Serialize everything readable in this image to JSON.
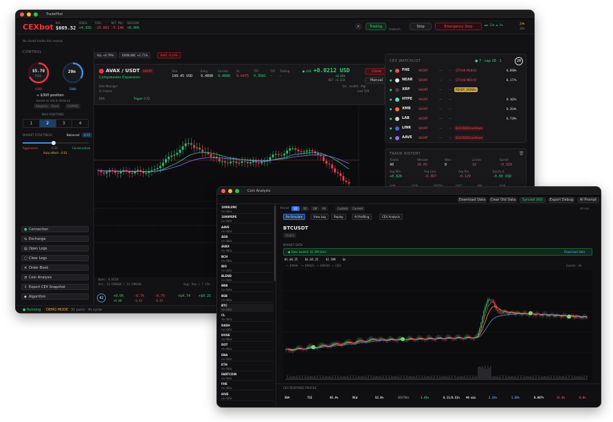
{
  "win1": {
    "title": "TradePilot",
    "logo": "CEXbot",
    "header": {
      "balance_label": "BAL",
      "balance": "$669.52",
      "gross_label": "GROSS",
      "gross": "+4.935",
      "fees_label": "FEES",
      "fees": "-10.081",
      "net_label": "NET PNL",
      "net": "-5.146",
      "session_label": "SESSION",
      "session": "+0.00%",
      "trading": "Trading",
      "trades_hr": "trades/h",
      "stop": "Stop",
      "emergency": "Emergency Stop",
      "right_top": "29%",
      "right_mid": "10%"
    },
    "notice": "No closed trades this session",
    "control": {
      "title": "CONTROL",
      "ring1_value": "$5.70",
      "ring1_label": "RISK",
      "ring2_value": "20m",
      "ring1_foot": "$760",
      "ring2_foot": "5000",
      "position": "≈ $300 position",
      "sub": "based on risk & distance",
      "chips": [
        "Adaptive",
        "Fixed",
        "CAPPED"
      ],
      "max_positions_label": "MAX POSITIONS",
      "positions": [
        "1",
        "2",
        "3",
        "4"
      ],
      "market_label": "MARKET STRICTNESS",
      "market_value": "Balanced",
      "market_badge": "0/10",
      "slider_left": "Aggressive",
      "slider_mid": "0.30",
      "slider_right": "Conservative",
      "auto_effect": "Auto effect: -0.01"
    },
    "side_buttons": [
      "Connection",
      "Exchange",
      "Open Logs",
      "Clear Logs",
      "Order Book",
      "Coin Analysis",
      "Export CEX Snapshot",
      "Algorithm"
    ],
    "status_bar": {
      "running": "Running",
      "demo": "DEMO MODE",
      "pairs": "30 pairs · 4s cycle"
    },
    "filters": [
      {
        "label": "ALL +0.79%",
        "color": "#34d27a"
      },
      {
        "label": "1000LUNC +1.71%",
        "color": "#34d27a"
      },
      {
        "label": "AVAX -0.24%",
        "color": "#ef4b55"
      }
    ],
    "position": {
      "symbol": "AVAX / USDT",
      "side": "SHORT",
      "strategy": "Compression Expansion",
      "size_label": "Size",
      "size": "199.45 USD",
      "entry_label": "Entry",
      "entry": "9.4898",
      "current_label": "Current",
      "current": "9.4880",
      "sl_label": "SL",
      "sl": "9.6475",
      "tp_label": "TP1",
      "tp": "9.3581",
      "tp2_label": "TP2",
      "tp2": "—",
      "trail_label": "Trailing",
      "trail": "—",
      "pnl": "+0.0212 USD",
      "pnl_pct": "+0.01%",
      "pnl_sub": "NET +0.038",
      "live": "LIVE",
      "close": "Close",
      "manual": "Manual",
      "info1": "Role Manager",
      "info2": "SL Frozen",
      "info3": "BNS",
      "info4": "Trigger 0.72",
      "timer": "5m · Health · Mgr",
      "last": "Last 500"
    },
    "chart_footer": {
      "open": "Open: 0.0128",
      "vol": "Vol: 23.599038 / 23.599038",
      "stats": "Avg: Rec / 7.15%",
      "pnl1": "+0.0%",
      "pnl1b": "+0.00",
      "pnl2": "-0.7%",
      "pnl2b": "-0.45",
      "pnl3": "-0.7%",
      "pnl3b": "-0.45",
      "pnl4": "+$4.74",
      "pnl5": "+$0.25",
      "circle": "42"
    },
    "watchlist": {
      "title": "CEX WATCHLIST",
      "meta": "● 7 · cap 28 · 1",
      "badge": "28",
      "rows": [
        {
          "sym": "FHE",
          "side": "SHORT",
          "pct": "0.098%",
          "ico": "#ef4b55",
          "tag": "QTF/48 M48/42",
          "tag_color": "#ef4b55",
          "tag_bg": "transparent"
        },
        {
          "sym": "NEAR",
          "side": "SHORT",
          "pct": "0.177%",
          "ico": "#e8e8ea",
          "tag": "QTF/48 M85/42",
          "tag_color": "#ef4b55",
          "tag_bg": "transparent"
        },
        {
          "sym": "XRP",
          "side": "SHORT",
          "pct": "",
          "ico": "#3c3c44",
          "tag": "READY_SIGNAL",
          "tag_color": "#0b0b0b",
          "tag_bg": "#d4a73a"
        },
        {
          "sym": "HYPE",
          "side": "SHORT",
          "pct": "0.102%",
          "ico": "#55e3c4",
          "tag": "",
          "tag_color": "",
          "tag_bg": ""
        },
        {
          "sym": "XMR",
          "side": "SHORT",
          "pct": "0.264%",
          "ico": "#f27830",
          "tag": "",
          "tag_color": "",
          "tag_bg": ""
        },
        {
          "sym": "LAB",
          "side": "SHORT",
          "pct": "0.739%",
          "ico": "#cfcfd4",
          "tag": "",
          "tag_color": "",
          "tag_bg": ""
        },
        {
          "sym": "LINK",
          "side": "SHORT",
          "pct": "",
          "ico": "#3a6cf0",
          "tag": "BLOCKED/cooldown",
          "tag_color": "#ef4b55",
          "tag_bg": "#3a1418"
        },
        {
          "sym": "AAVE",
          "side": "SHORT",
          "pct": "",
          "ico": "#9d6af0",
          "tag": "BLOCKED/cooldown",
          "tag_color": "#ef4b55",
          "tag_bg": "#3a1418"
        }
      ]
    },
    "history": {
      "title": "TRADE HISTORY",
      "cols": [
        "Trades",
        "Winrate",
        "Wins",
        "Losses",
        "Sumdl"
      ],
      "vals": [
        "40",
        "20.0%",
        "8",
        "32",
        "-0.329"
      ],
      "row2_labels": [
        "Avg Win",
        "Avg Loss",
        "Avg PnL",
        "Equity Δ"
      ],
      "row2_vals": [
        "+0.826",
        "-0.367",
        "-0.129",
        "-0.00 USD"
      ],
      "table_head": [
        "SYM",
        "SIDE",
        "ENTRY",
        "EXIT",
        "PNL",
        "DUR"
      ]
    }
  },
  "win2": {
    "title": "Coin Analysis",
    "buttons": [
      "Download Data",
      "Clear Old Data",
      "Synced (60)",
      "Export Debug",
      "AI Prompt"
    ],
    "period_label": "Period",
    "periods": [
      "1D",
      "3D",
      "1W",
      "All",
      "Custom",
      "Current"
    ],
    "actions": [
      "Re-Simulate",
      "View Log",
      "Replay",
      "AI Profiling",
      "CEX Analysis"
    ],
    "actions_right": "All sim",
    "symbol": "BTCUSDT",
    "subtitle": "Global",
    "section": "MARKET DATA",
    "loaded": "Data loaded: 42 399 bars",
    "download": "Download data",
    "legend": [
      "EMA9",
      "EMA21",
      "EMA50",
      "CEX"
    ],
    "chart_right": "Events · 4h",
    "list": [
      {
        "sym": "1000LUNC",
        "sub": "no data"
      },
      {
        "sym": "1000PEPE",
        "sub": "no data"
      },
      {
        "sym": "AAVE",
        "sub": "no data"
      },
      {
        "sym": "ADA",
        "sub": "no data"
      },
      {
        "sym": "AVAX",
        "sub": "no data"
      },
      {
        "sym": "BCH",
        "sub": "no data"
      },
      {
        "sym": "BIO",
        "sub": "no data"
      },
      {
        "sym": "BLEND",
        "sub": "no data"
      },
      {
        "sym": "BNB",
        "sub": "no data"
      },
      {
        "sym": "BSB",
        "sub": "no data"
      },
      {
        "sym": "BTC",
        "sub": "no data"
      },
      {
        "sym": "CL",
        "sub": "no data"
      },
      {
        "sym": "DASH",
        "sub": "no data"
      },
      {
        "sym": "DOGE",
        "sub": "no data"
      },
      {
        "sym": "DOT",
        "sub": "no data"
      },
      {
        "sym": "ENA",
        "sub": "no data"
      },
      {
        "sym": "ETH",
        "sub": "no data"
      },
      {
        "sym": "FARTCOIN",
        "sub": "no data"
      },
      {
        "sym": "FHE",
        "sub": "no data"
      },
      {
        "sym": "HIVE",
        "sub": "no data"
      }
    ],
    "footer_title": "CEX RESPONSE PROFILE",
    "footer_vals": [
      "304",
      "732",
      "65.4%",
      "Mid",
      "53.0%",
      "NEUTRAL",
      "1.41%",
      "0.11/0.51%",
      "49 min",
      "2.15%",
      "1.58%",
      "0.067%",
      "11.9%",
      "0.9%"
    ]
  }
}
